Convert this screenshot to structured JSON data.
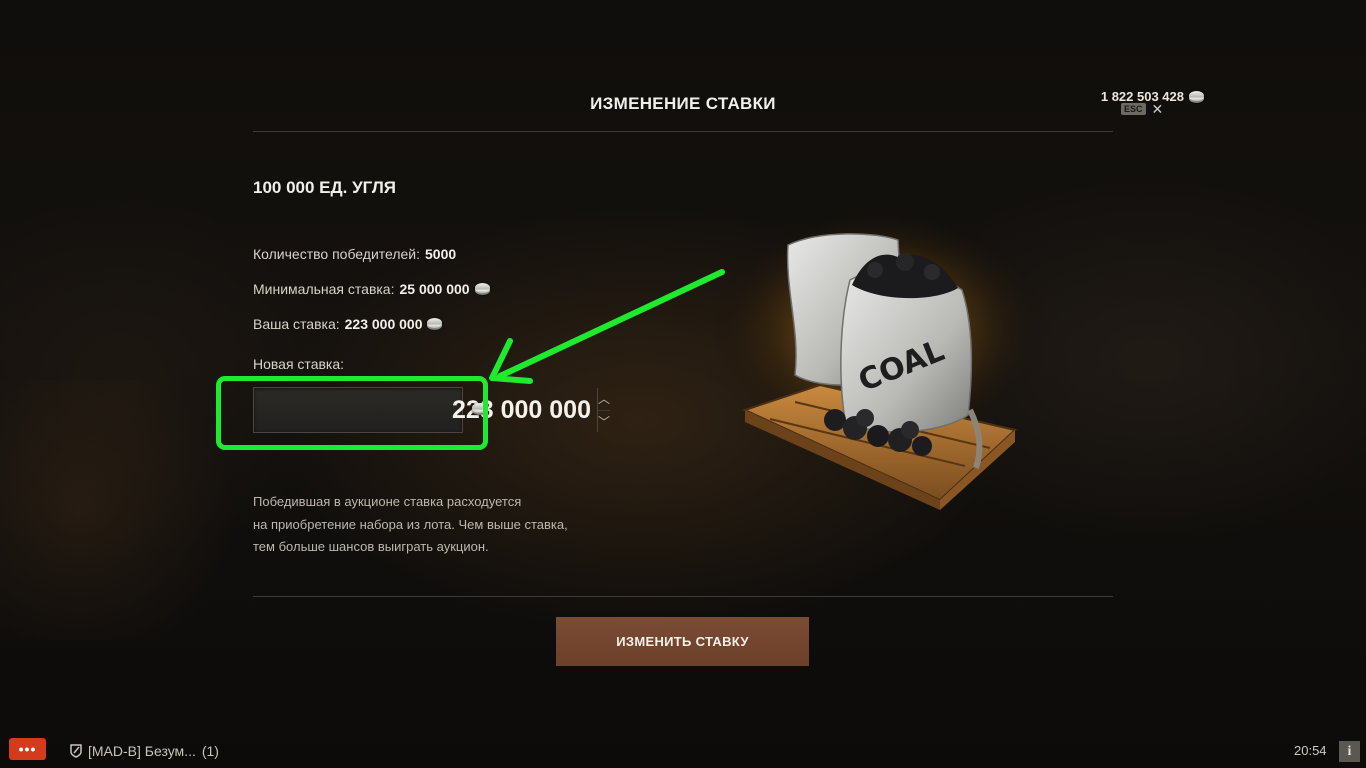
{
  "header": {
    "title": "ИЗМЕНЕНИЕ СТАВКИ",
    "balance": "1 822 503 428",
    "esc_label": "ESC",
    "close_glyph": "✕"
  },
  "lot": {
    "title": "100 000 ЕД. УГЛЯ",
    "image_caption": "COAL"
  },
  "info": {
    "winners_label": "Количество победителей:",
    "winners_value": "5000",
    "min_bid_label": "Минимальная ставка:",
    "min_bid_value": "25 000 000",
    "your_bid_label": "Ваша ставка:",
    "your_bid_value": "223 000 000"
  },
  "bid_input": {
    "label": "Новая ставка:",
    "value": "223 000 000",
    "up_glyph": "︿",
    "down_glyph": "﹀"
  },
  "description": {
    "line1": "Победившая в аукционе ставка расходуется",
    "line2": "на приобретение набора из лота. Чем выше ставка,",
    "line3": "тем больше шансов выиграть аукцион."
  },
  "submit_label": "ИЗМЕНИТЬ СТАВКУ",
  "footer": {
    "chat_glyph": "•••",
    "chat_tab": "[MAD-B] Безум...",
    "chat_count": "(1)",
    "clock": "20:54",
    "info_glyph": "i"
  },
  "colors": {
    "highlight": "#1eea2e",
    "button": "#6c4029",
    "chat_button": "#d43a1c"
  },
  "icons": [
    "coin-icon",
    "close-icon",
    "chevron-up-icon",
    "chevron-down-icon",
    "chat-icon",
    "clan-icon",
    "info-icon",
    "arrow-annotation"
  ]
}
